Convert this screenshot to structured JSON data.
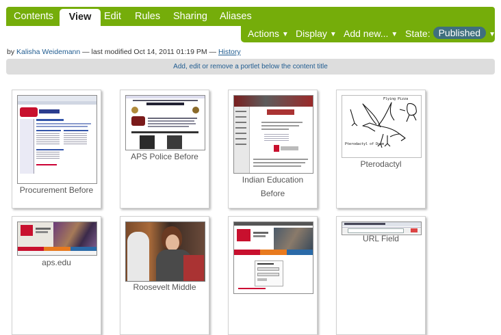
{
  "tabs": {
    "contents": "Contents",
    "view": "View",
    "edit": "Edit",
    "rules": "Rules",
    "sharing": "Sharing",
    "aliases": "Aliases"
  },
  "actions": {
    "actions_label": "Actions",
    "display_label": "Display",
    "add_new_label": "Add new...",
    "state_label": "State:",
    "state_value": "Published"
  },
  "byline": {
    "prefix": "by",
    "author": "Kalisha Weidemann",
    "modified": "— last modified Oct 14, 2011 01:19 PM —",
    "history_link": "History"
  },
  "portlet_bar": {
    "text": "Add, edit or remove a portlet below the content title"
  },
  "cards": [
    {
      "title": "Procurement Before"
    },
    {
      "title": "APS Police Before"
    },
    {
      "title_line1": "Indian Education",
      "title_line2": "Before"
    },
    {
      "title": "Pterodactyl"
    },
    {
      "title": "aps.edu"
    },
    {
      "title": "Roosevelt Middle"
    },
    {
      "title": ""
    },
    {
      "title": "URL Field"
    }
  ],
  "thumb_text": {
    "pterodactyl_flying": "Flying Pizza",
    "pterodactyl_caption": "Pterodactyl of Doom"
  },
  "colors": {
    "brand_green": "#75ad0a",
    "state_pill": "#3f6f7e",
    "link_blue": "#205c90",
    "aps_red": "#c8102e"
  }
}
